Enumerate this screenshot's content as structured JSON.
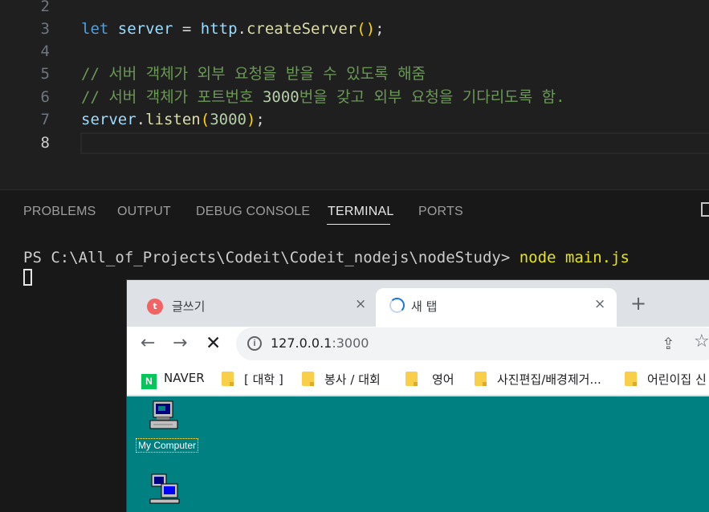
{
  "editor": {
    "lines": [
      {
        "num": "2",
        "active": false
      },
      {
        "num": "3",
        "active": false,
        "parts": [
          [
            "kw",
            "let"
          ],
          [
            "op",
            " "
          ],
          [
            "var",
            "server"
          ],
          [
            "op",
            " = "
          ],
          [
            "var",
            "http"
          ],
          [
            "op",
            "."
          ],
          [
            "fn",
            "createServer"
          ],
          [
            "paren",
            "()"
          ],
          [
            "op",
            ";"
          ]
        ]
      },
      {
        "num": "4",
        "active": false
      },
      {
        "num": "5",
        "active": false,
        "parts": [
          [
            "cmt",
            "// 서버 객체가 외부 요청을 받을 수 있도록 해줌"
          ]
        ]
      },
      {
        "num": "6",
        "active": false,
        "parts": [
          [
            "cmt",
            "// 서버 객체가 포트번호 "
          ],
          [
            "num",
            "3000"
          ],
          [
            "cmt",
            "번을 갖고 외부 요청을 기다리도록 함."
          ]
        ]
      },
      {
        "num": "7",
        "active": false,
        "parts": [
          [
            "var",
            "server"
          ],
          [
            "op",
            "."
          ],
          [
            "fn",
            "listen"
          ],
          [
            "paren",
            "("
          ],
          [
            "num",
            "3000"
          ],
          [
            "paren",
            ")"
          ],
          [
            "op",
            ";"
          ]
        ]
      },
      {
        "num": "8",
        "active": true
      }
    ]
  },
  "panel": {
    "tabs": [
      {
        "label": "PROBLEMS"
      },
      {
        "label": "OUTPUT"
      },
      {
        "label": "DEBUG CONSOLE"
      },
      {
        "label": "TERMINAL"
      },
      {
        "label": "PORTS"
      }
    ],
    "active_tab": "TERMINAL",
    "terminal": {
      "prompt": "PS C:\\All_of_Projects\\Codeit\\Codeit_nodejs\\nodeStudy> ",
      "command": "node main.js"
    }
  },
  "browser": {
    "tabs": [
      {
        "title": "글쓰기",
        "close": "×"
      },
      {
        "title": "새 탭",
        "close": "×"
      }
    ],
    "new_tab": "+",
    "nav": {
      "back": "←",
      "forward": "→",
      "stop": "✕"
    },
    "url_host": "127.0.0.1",
    "url_port": ":3000",
    "bookmarks": [
      {
        "label": "NAVER",
        "icon": "naver-icon"
      },
      {
        "label": "[ 대학 ]",
        "icon": "folder-icon"
      },
      {
        "label": "봉사 / 대회",
        "icon": "folder-icon"
      },
      {
        "label": "영어",
        "icon": "folder-icon"
      },
      {
        "label": "사진편집/배경제거...",
        "icon": "folder-icon"
      },
      {
        "label": "어린이집 신",
        "icon": "folder-icon"
      }
    ],
    "desktop": {
      "icons": [
        {
          "label": "My Computer",
          "icon": "my-computer-icon"
        },
        {
          "label": "",
          "icon": "network-icon"
        }
      ]
    }
  },
  "colors": {
    "editor_bg": "#1f1f1f",
    "desktop_teal": "#008080",
    "naver_green": "#03c75a",
    "folder_yellow": "#f9cf4a"
  }
}
